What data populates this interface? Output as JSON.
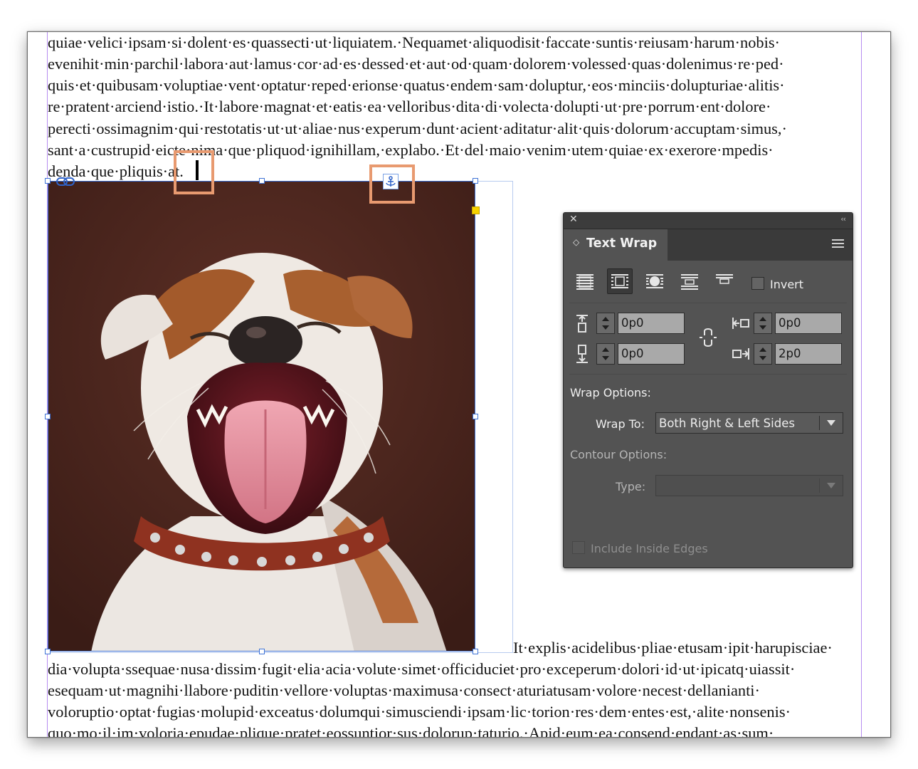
{
  "document": {
    "body_lines_top": [
      "quiae·velici·ipsam·si·dolent·es·quassecti·ut·liquiatem.·Nequamet·aliquodisit·faccate·suntis·reiusam·harum·nobis·",
      "evenihit·min·parchil·labora·aut·lamus·cor·ad·es·dessed·et·aut·od·quam·dolorem·volessed·quas·dolenimus·re·ped·",
      "quis·et·quibusam·voluptiae·vent·optatur·reped·erionse·quatus·endem·sam·doluptur,·eos·minciis·dolupturiae·alitis·",
      "re·pratent·arciend·istio.·It·labore·magnat·et·eatis·ea·velloribus·dita·di·volecta·dolupti·ut·pre·porrum·ent·dolore·",
      "perecti·ossimagnim·qui·restotatis·ut·ut·aliae·nus·experum·dunt·acient·aditatur·alit·quis·dolorum·accuptam·simus,·",
      "sant·a·custrupid·eicte·nima·que·pliquod·ignihillam,·explabo.·Et·del·maio·venim·utem·quiae·ex·exerore·mpedis·"
    ],
    "last_short_line": "denda·que·pliquis·at.",
    "wrap_line_after_image": "It·explis·acidelibus·pliae·etusam·ipit·harupisciae·",
    "body_lines_bottom": [
      "dia·volupta·ssequae·nusa·dissim·fugit·elia·acia·volute·simet·officiduciet·pro·exceperum·dolori·id·ut·ipicatq·uiassit·",
      "esequam·ut·magnihi·llabore·puditin·vellore·voluptas·maximusa·consect·aturiatusam·volore·necest·dellanianti·",
      "voloruptio·optat·fugias·molupid·exceatus·dolumqui·simusciendi·ipsam·lic·torion·res·dem·entes·est,·alite·nonsenis·",
      "quo·mo·il·im·voloria·epudae·plique·pratet·eossuntior·sus·dolorup·taturio.·Apid·eum·ea·consend·endant·as·sum·"
    ],
    "image": {
      "subject": "yawning Jack Russell terrier with studded red collar on brown backdrop"
    }
  },
  "text_wrap_panel": {
    "close_glyph": "✕",
    "collapse_glyph": "‹‹",
    "tab_arrows": "◇",
    "title": "Text Wrap",
    "wrap_buttons": [
      {
        "name": "no-text-wrap",
        "selected": false
      },
      {
        "name": "wrap-around-bounding-box",
        "selected": true
      },
      {
        "name": "wrap-around-object-shape",
        "selected": false
      },
      {
        "name": "jump-object",
        "selected": false
      },
      {
        "name": "jump-to-next-column",
        "selected": false
      }
    ],
    "invert_label": "Invert",
    "invert_checked": false,
    "offsets": {
      "top": "0p0",
      "bottom": "0p0",
      "left": "0p0",
      "right": "2p0"
    },
    "wrap_options_label": "Wrap Options:",
    "wrap_to_label": "Wrap To:",
    "wrap_to_value": "Both Right & Left Sides",
    "contour_options_label": "Contour Options:",
    "type_label": "Type:",
    "type_value": "",
    "include_inside_edges_label": "Include Inside Edges",
    "include_inside_edges_checked": false
  }
}
